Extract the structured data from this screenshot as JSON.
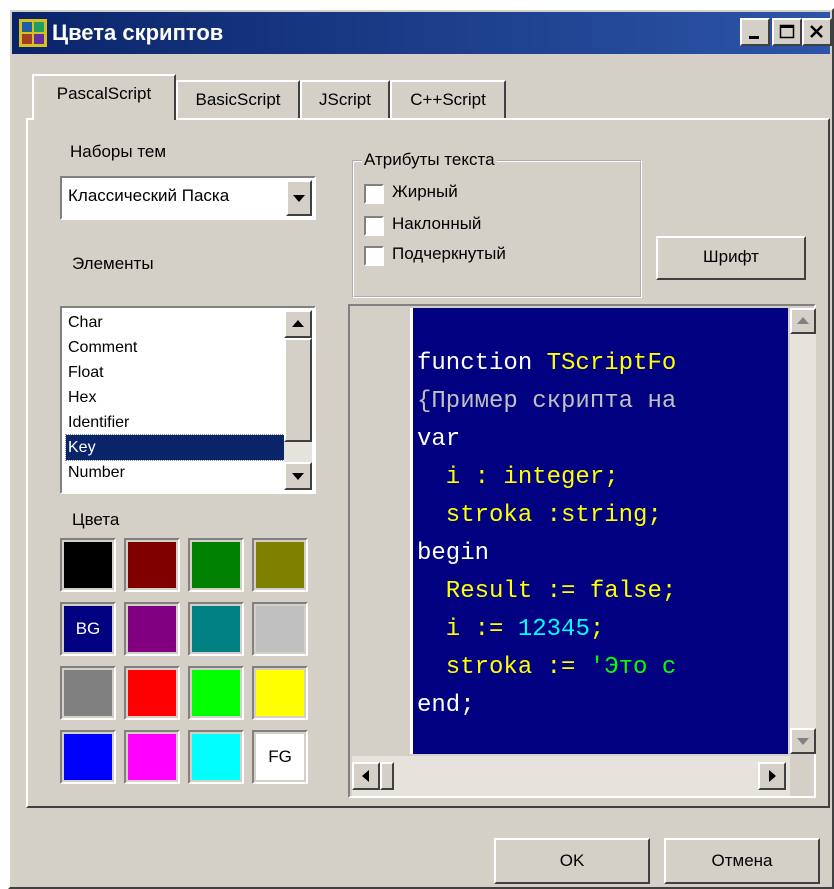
{
  "window": {
    "title": "Цвета скриптов"
  },
  "tabs": [
    "PascalScript",
    "BasicScript",
    "JScript",
    "C++Script"
  ],
  "themes": {
    "label": "Наборы тем",
    "value": "Классический Паска"
  },
  "elements": {
    "label": "Элементы",
    "items": [
      "Char",
      "Comment",
      "Float",
      "Hex",
      "Identifier",
      "Key",
      "Number"
    ],
    "selected": "Key"
  },
  "colors": {
    "label": "Цвета",
    "swatches": [
      {
        "color": "#000000",
        "mark": ""
      },
      {
        "color": "#800000",
        "mark": ""
      },
      {
        "color": "#008000",
        "mark": ""
      },
      {
        "color": "#808000",
        "mark": ""
      },
      {
        "color": "#000080",
        "mark": "BG"
      },
      {
        "color": "#800080",
        "mark": ""
      },
      {
        "color": "#008080",
        "mark": ""
      },
      {
        "color": "#c0c0c0",
        "mark": ""
      },
      {
        "color": "#808080",
        "mark": ""
      },
      {
        "color": "#ff0000",
        "mark": ""
      },
      {
        "color": "#00ff00",
        "mark": ""
      },
      {
        "color": "#ffff00",
        "mark": ""
      },
      {
        "color": "#0000ff",
        "mark": ""
      },
      {
        "color": "#ff00ff",
        "mark": ""
      },
      {
        "color": "#00ffff",
        "mark": ""
      },
      {
        "color": "#ffffff",
        "mark": "FG"
      }
    ]
  },
  "attributes": {
    "label": "Атрибуты текста",
    "bold": "Жирный",
    "italic": "Наклонный",
    "underline": "Подчеркнутый",
    "bold_checked": false,
    "italic_checked": false,
    "underline_checked": false
  },
  "font_button": "Шрифт",
  "code": {
    "background": "#000080",
    "lines": [
      [
        {
          "t": "function ",
          "c": "#ffffff"
        },
        {
          "t": "TScriptFo",
          "c": "#ffff00"
        }
      ],
      [
        {
          "t": "{Пример скрипта на",
          "c": "#c0c0c0"
        }
      ],
      [
        {
          "t": "var",
          "c": "#ffffff"
        }
      ],
      [
        {
          "t": "  i : integer;",
          "c": "#ffff00"
        }
      ],
      [
        {
          "t": "  stroka :string;",
          "c": "#ffff00"
        }
      ],
      [
        {
          "t": "begin",
          "c": "#ffffff"
        }
      ],
      [
        {
          "t": "  Result := false;",
          "c": "#ffff00"
        }
      ],
      [
        {
          "t": "  i := ",
          "c": "#ffff00"
        },
        {
          "t": "12345",
          "c": "#00ffff"
        },
        {
          "t": ";",
          "c": "#ffff00"
        }
      ],
      [
        {
          "t": "  stroka := ",
          "c": "#ffff00"
        },
        {
          "t": "'Это с",
          "c": "#00ff00"
        }
      ],
      [
        {
          "t": "end;",
          "c": "#ffffff"
        }
      ]
    ]
  },
  "buttons": {
    "ok": "OK",
    "cancel": "Отмена"
  }
}
